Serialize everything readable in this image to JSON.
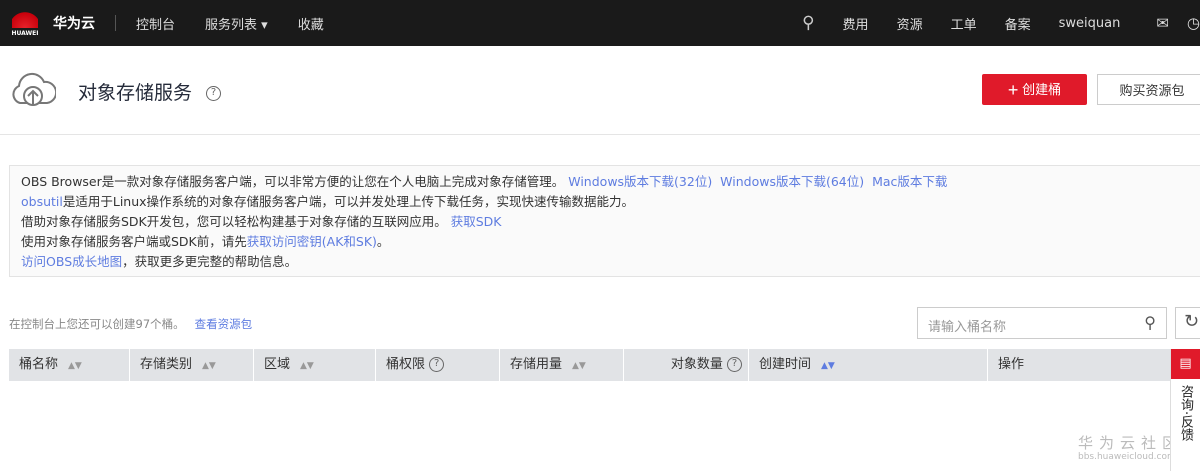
{
  "topbar": {
    "logo_text": "HUAWEI",
    "brand": "华为云",
    "nav": [
      "控制台",
      "服务列表 ▾",
      "收藏"
    ],
    "right": [
      "费用",
      "资源",
      "工单",
      "备案",
      "sweiquan"
    ]
  },
  "header": {
    "title": "对象存储服务",
    "create_label": "创建桶",
    "buy_label": "购买资源包"
  },
  "info": {
    "line1_text": "OBS Browser是一款对象存储服务客户端，可以非常方便的让您在个人电脑上完成对象存储管理。",
    "link_win32": "Windows版本下载(32位)",
    "link_win64": "Windows版本下载(64位)",
    "link_mac": "Mac版本下载",
    "line2_link": "obsutil",
    "line2_text": "是适用于Linux操作系统的对象存储服务客户端，可以并发处理上传下载任务，实现快速传输数据能力。",
    "line3_text": "借助对象存储服务SDK开发包，您可以轻松构建基于对象存储的互联网应用。",
    "line3_link": "获取SDK",
    "line4_text": "使用对象存储服务客户端或SDK前，请先",
    "line4_link": "获取访问密钥(AK和SK)",
    "line4_end": "。",
    "line5_link": "访问OBS成长地图",
    "line5_text": "，获取更多更完整的帮助信息。"
  },
  "quota": {
    "text": "在控制台上您还可以创建97个桶。",
    "link": "查看资源包"
  },
  "search": {
    "placeholder": "请输入桶名称"
  },
  "table": {
    "columns": [
      "桶名称",
      "存储类别",
      "区域",
      "桶权限",
      "存储用量",
      "对象数量",
      "创建时间",
      "操作"
    ]
  },
  "float": {
    "label": "咨询·反馈"
  },
  "watermark": {
    "title": "华为云社区",
    "url": "bbs.huaweicloud.com"
  }
}
